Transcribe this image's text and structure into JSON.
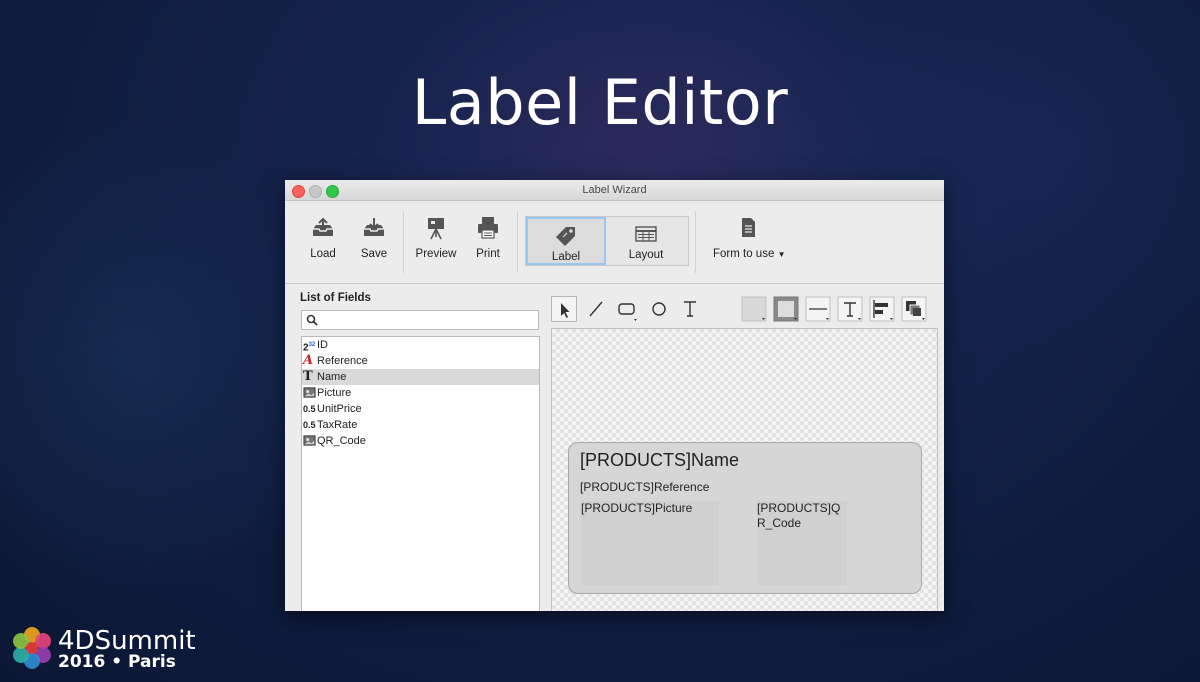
{
  "slide": {
    "title": "Label Editor"
  },
  "window": {
    "title": "Label Wizard"
  },
  "toolbar": {
    "load_label": "Load",
    "save_label": "Save",
    "preview_label": "Preview",
    "print_label": "Print",
    "label_tab": "Label",
    "layout_tab": "Layout",
    "form_to_use_label": "Form to use"
  },
  "fields_panel": {
    "title": "List of Fields",
    "search_placeholder": "",
    "fields": [
      {
        "icon": "number-icon",
        "name": "ID"
      },
      {
        "icon": "alpha-icon",
        "name": "Reference"
      },
      {
        "icon": "text-icon",
        "name": "Name",
        "selected": true
      },
      {
        "icon": "picture-icon",
        "name": "Picture"
      },
      {
        "icon": "real-icon",
        "name": "UnitPrice"
      },
      {
        "icon": "real-icon",
        "name": "TaxRate"
      },
      {
        "icon": "picture-icon",
        "name": "QR_Code"
      }
    ]
  },
  "label_preview": {
    "name_field": "[PRODUCTS]Name",
    "reference_field": "[PRODUCTS]Reference",
    "picture_field": "[PRODUCTS]Picture",
    "qr_field_line1": "[PRODUCTS]Q",
    "qr_field_line2": "R_Code"
  },
  "branding": {
    "logo_line1": "4DSummit",
    "logo_line2": "2016 • Paris"
  }
}
